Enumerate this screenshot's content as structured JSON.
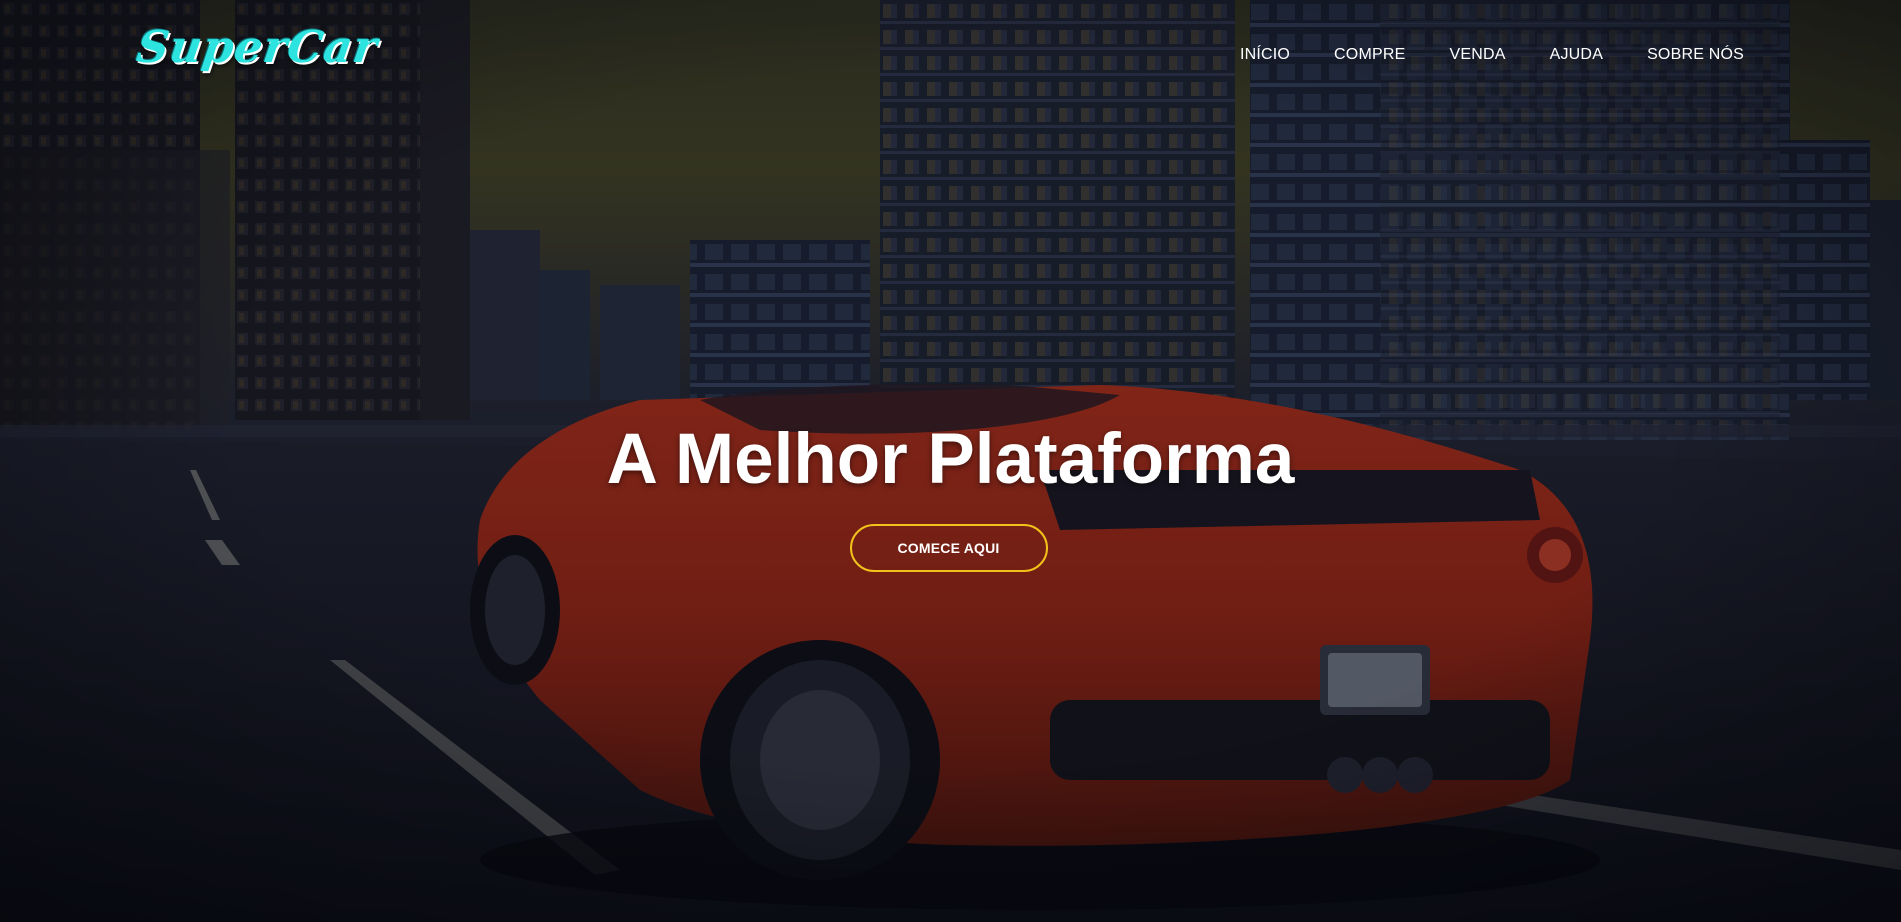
{
  "brand": {
    "logo_text": "SuperCar",
    "logo_color": "#2de3df"
  },
  "nav": {
    "items": [
      {
        "label": "INÍCIO"
      },
      {
        "label": "COMPRE"
      },
      {
        "label": "VENDA"
      },
      {
        "label": "AJUDA"
      },
      {
        "label": "SOBRE NÓS"
      }
    ]
  },
  "hero": {
    "title": "A Melhor Plataforma",
    "cta_label": "COMECE AQUI",
    "cta_border_color": "#f2c21a",
    "background": "red sports car on city road at dusk, darkened"
  }
}
